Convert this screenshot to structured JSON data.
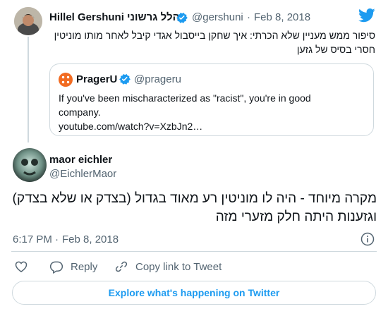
{
  "parent_tweet": {
    "author_name_en": "Hillel Gershuni",
    "author_name_he": "הלל גרשוני",
    "handle": "@gershuni",
    "separator": "·",
    "date": "Feb 8, 2018",
    "text_line1": "סיפור ממש מעניין שלא הכרתי: איך שחקן בייסבול אגדי קיבל לאחר מותו מוניטין",
    "text_line2": "חסרי בסיס של גזען",
    "avatar_icon": "person-avatar",
    "verified_icon": "verified-badge-icon"
  },
  "quoted_tweet": {
    "author_name": "PragerU",
    "handle": "@prageru",
    "text_line1": "If you've been mischaracterized as \"racist\", you're in good",
    "text_line2": "company.",
    "link": "youtube.com/watch?v=XzbJn2…"
  },
  "main_tweet": {
    "author_name": "maor eichler",
    "handle": "@EichlerMaor",
    "text_line1": "מקרה מיוחד - היה לו מוניטין רע מאוד בגדול (בצדק או שלא בצדק)",
    "text_line2": "וגזענות היתה חלק מזערי מזה",
    "time": "6:17 PM",
    "separator": "·",
    "date": "Feb 8, 2018"
  },
  "actions": {
    "like_icon": "heart-icon",
    "reply_label": "Reply",
    "copy_label": "Copy link to Tweet"
  },
  "footer": {
    "explore_label": "Explore what's happening on Twitter"
  },
  "colors": {
    "brand_blue": "#1d9bf0",
    "muted": "#536471",
    "border": "#cfd9de",
    "prageru_orange": "#f26b21"
  }
}
